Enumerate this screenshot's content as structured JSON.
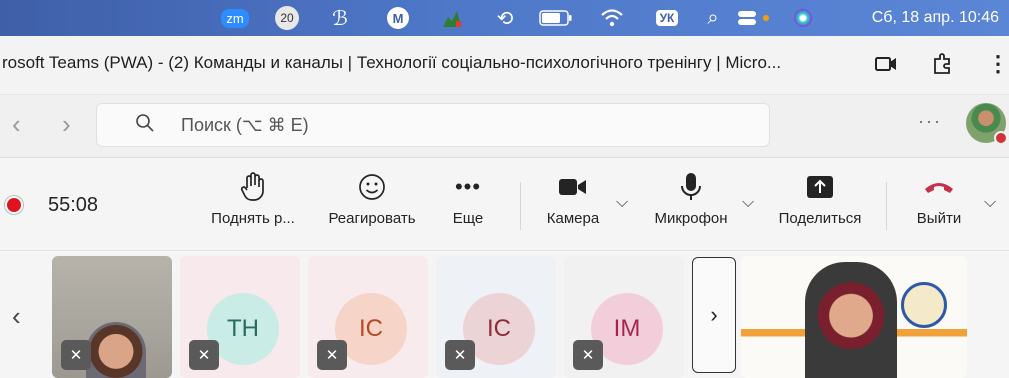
{
  "menubar": {
    "items": [
      {
        "icon": "zoom-icon",
        "text": "zm"
      },
      {
        "icon": "badge-count-icon",
        "text": "20"
      },
      {
        "icon": "script-icon",
        "text": "ℬ"
      },
      {
        "icon": "mail-icon",
        "text": "M"
      },
      {
        "icon": "chart-icon",
        "text": ""
      },
      {
        "icon": "history-icon",
        "text": "⟲"
      },
      {
        "icon": "battery-icon",
        "text": ""
      },
      {
        "icon": "wifi-icon",
        "text": ""
      },
      {
        "icon": "keyboard-layout-icon",
        "text": "УК"
      },
      {
        "icon": "spotlight-icon",
        "text": "⌕"
      },
      {
        "icon": "control-center-icon",
        "text": ""
      },
      {
        "icon": "siri-icon",
        "text": ""
      }
    ],
    "clock": "Сб, 18 апр.  10:46"
  },
  "window": {
    "title": "rosoft Teams (PWA) - (2) Команды и каналы | Технології соціально-психологічного тренінгу | Micro..."
  },
  "search": {
    "placeholder": "Поиск (⌥ ⌘ E)"
  },
  "meeting": {
    "timer": "55:08",
    "controls": [
      {
        "name": "raise-hand",
        "icon": "hand-icon",
        "label": "Поднять р..."
      },
      {
        "name": "react",
        "icon": "smiley-icon",
        "label": "Реагировать"
      },
      {
        "name": "more",
        "icon": "more-dots-icon",
        "label": "Еще"
      },
      {
        "name": "camera",
        "icon": "camera-icon",
        "label": "Камера"
      },
      {
        "name": "mic",
        "icon": "microphone-icon",
        "label": "Микрофон"
      },
      {
        "name": "share",
        "icon": "share-icon",
        "label": "Поделиться"
      },
      {
        "name": "leave",
        "icon": "phone-hangup-icon",
        "label": "Выйти"
      }
    ]
  },
  "participants": [
    {
      "initials": "",
      "video": true
    },
    {
      "initials": "TH",
      "bg": "#f7e9ec",
      "circle": "#c9ece6",
      "text": "#2a6a62"
    },
    {
      "initials": "IC",
      "bg": "#f8ebee",
      "circle": "#f6d4c8",
      "text": "#b44a24"
    },
    {
      "initials": "IC",
      "bg": "#eef1f6",
      "circle": "#ecd3d6",
      "text": "#8a2e3a"
    },
    {
      "initials": "IM",
      "bg": "#f1f1f1",
      "circle": "#f2cedb",
      "text": "#a4264f"
    }
  ],
  "colors": {
    "record": "#e1141e",
    "leave": "#c4314b"
  }
}
